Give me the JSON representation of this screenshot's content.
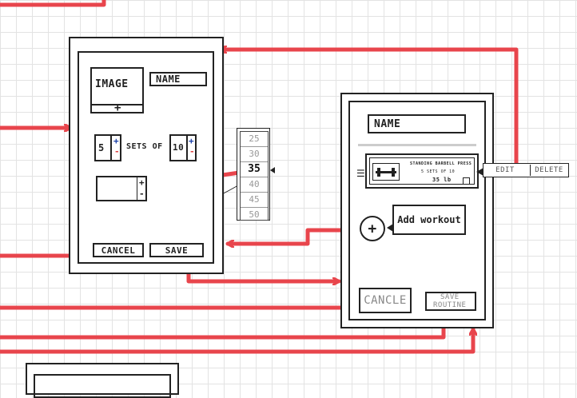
{
  "form": {
    "image_label": "IMAGE",
    "image_add": "+",
    "name_label": "NAME",
    "sets_value": "5",
    "sets_of_label": "SETS OF",
    "reps_value": "10",
    "stepper_plus": "+",
    "stepper_minus": "-",
    "cancel_label": "CANCEL",
    "save_label": "SAVE"
  },
  "picker": {
    "values": [
      "25",
      "30",
      "35",
      "40",
      "45",
      "50"
    ],
    "selected": "35"
  },
  "routine": {
    "name_label": "NAME",
    "exercise_title": "STANDING BARBELL PRESS",
    "exercise_sets": "5 SETS OF 10",
    "exercise_weight": "35 lb",
    "edit_label": "EDIT",
    "delete_label": "DELETE",
    "add_icon": "+",
    "add_workout_label": "Add workout",
    "cancel_label": "CANCLE",
    "save_label_line1": "SAVE",
    "save_label_line2": "ROUTINE"
  },
  "colors": {
    "arrow": "#e8454c",
    "stroke": "#222222",
    "accent_blue": "#1a3fa8"
  }
}
